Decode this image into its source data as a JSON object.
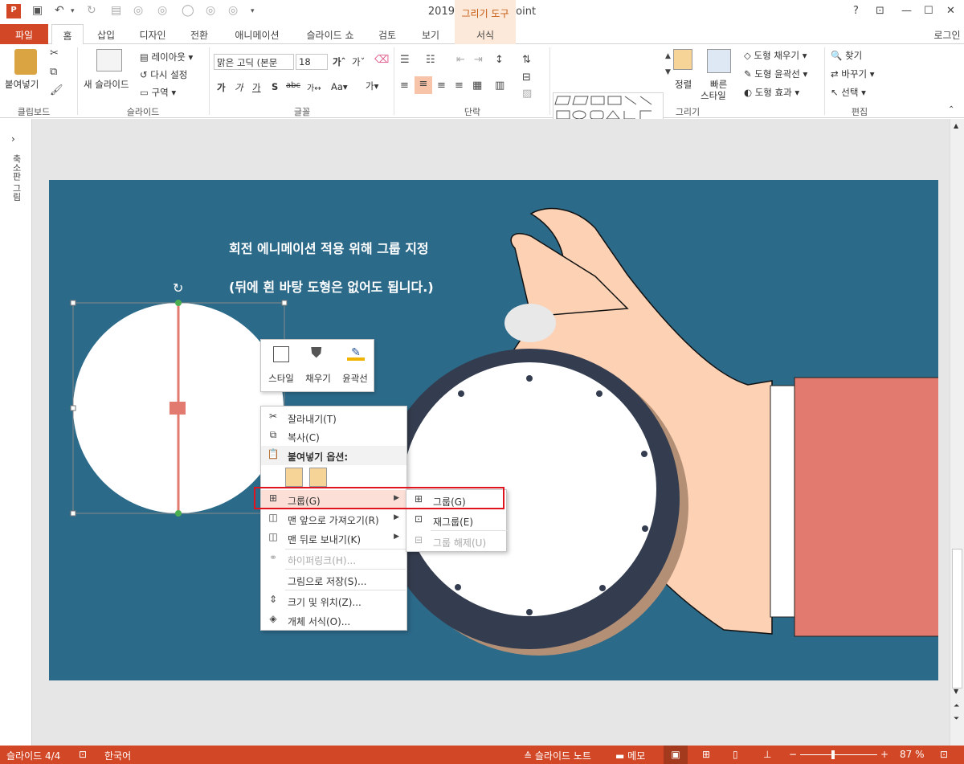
{
  "window": {
    "title": "201906 - PowerPoint",
    "context_tool": "그리기 도구",
    "help": "?",
    "signin": "로그인"
  },
  "tabs": [
    {
      "label": "파일"
    },
    {
      "label": "홈"
    },
    {
      "label": "삽입"
    },
    {
      "label": "디자인"
    },
    {
      "label": "전환"
    },
    {
      "label": "애니메이션"
    },
    {
      "label": "슬라이드 쇼"
    },
    {
      "label": "검토"
    },
    {
      "label": "보기"
    },
    {
      "label": "서식"
    }
  ],
  "ribbon": {
    "clipboard": {
      "paste": "붙여넣기",
      "label": "클립보드"
    },
    "slides": {
      "new_slide": "새 슬라이드",
      "layout": "레이아웃",
      "reset": "다시 설정",
      "section": "구역",
      "label": "슬라이드"
    },
    "font": {
      "name": "맑은 고딕 (본문",
      "size": "18",
      "label": "글꼴"
    },
    "paragraph": {
      "label": "단락"
    },
    "drawing": {
      "arrange": "정렬",
      "quick_styles_1": "빠른",
      "quick_styles_2": "스타일",
      "fill": "도형 채우기",
      "outline": "도형 윤곽선",
      "effects": "도형 효과",
      "label": "그리기"
    },
    "editing": {
      "find": "찾기",
      "replace": "바꾸기",
      "select": "선택",
      "label": "편집"
    }
  },
  "left_pane": {
    "label": "축소판 그림"
  },
  "slide": {
    "line1": "회전 에니메이션 적용 위해 그룹 지정",
    "line2": "(뒤에 흰 바탕 도형은 없어도 됩니다.)",
    "background_color": "#2c6a8a"
  },
  "mini_toolbar": [
    {
      "label": "스타일",
      "icon": "style-icon"
    },
    {
      "label": "채우기",
      "icon": "fill-bucket-icon"
    },
    {
      "label": "윤곽선",
      "icon": "outline-pen-icon"
    }
  ],
  "context_menu": {
    "items": [
      {
        "label": "잘라내기(T)",
        "icon": "scissors-icon",
        "disabled": false
      },
      {
        "label": "복사(C)",
        "icon": "copy-icon",
        "disabled": false
      },
      {
        "label": "붙여넣기 옵션:",
        "icon": "paste-icon",
        "disabled": false
      },
      {
        "label": "그룹(G)",
        "icon": "group-icon",
        "disabled": false
      },
      {
        "label": "맨 앞으로 가져오기(R)",
        "icon": "bring-front-icon",
        "disabled": false
      },
      {
        "label": "맨 뒤로 보내기(K)",
        "icon": "send-back-icon",
        "disabled": false
      },
      {
        "label": "하이퍼링크(H)...",
        "icon": "hyperlink-icon",
        "disabled": true
      },
      {
        "label": "그림으로 저장(S)...",
        "icon": "",
        "disabled": false
      },
      {
        "label": "크기 및 위치(Z)...",
        "icon": "size-position-icon",
        "disabled": false
      },
      {
        "label": "개체 서식(O)...",
        "icon": "format-object-icon",
        "disabled": false
      }
    ]
  },
  "submenu": {
    "items": [
      {
        "label": "그룹(G)",
        "icon": "group-icon",
        "disabled": false
      },
      {
        "label": "재그룹(E)",
        "icon": "regroup-icon",
        "disabled": false
      },
      {
        "label": "그룹 해제(U)",
        "icon": "ungroup-icon",
        "disabled": true
      }
    ]
  },
  "status": {
    "slide": "슬라이드 4/4",
    "language": "한국어",
    "notes": "슬라이드 노트",
    "comments": "메모",
    "zoom": "87 %",
    "zoom_value": 87
  },
  "colors": {
    "accent": "#d24726",
    "highlight": "#e0141e",
    "sleeve": "#e27a6f",
    "skin": "#fcd1b4",
    "watch_ring": "#343d4f"
  }
}
